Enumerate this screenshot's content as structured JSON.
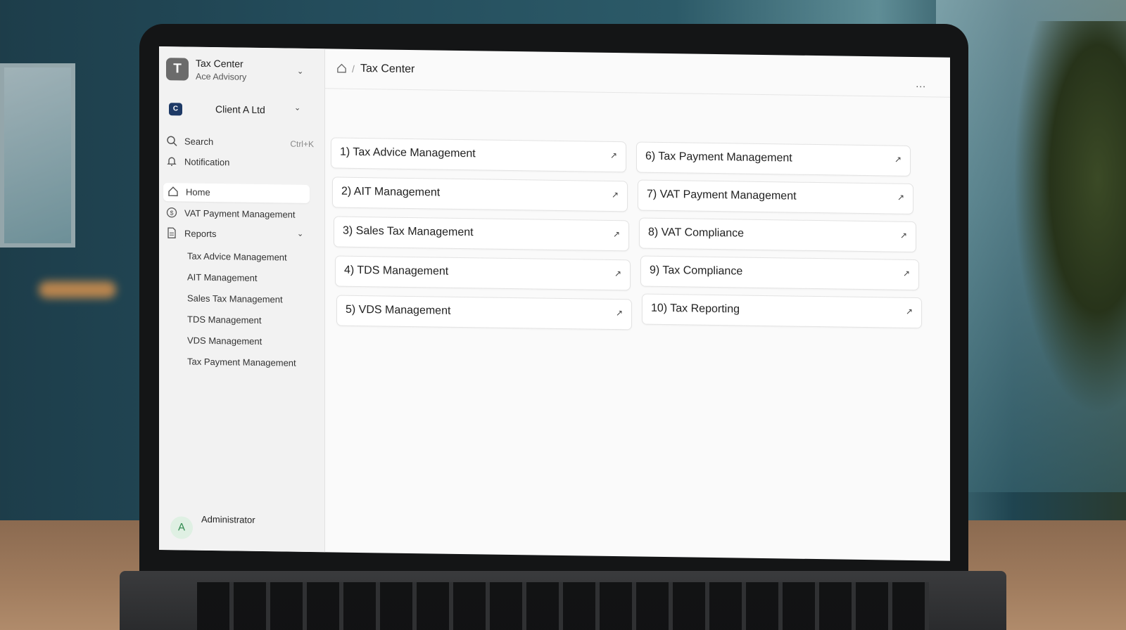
{
  "sidebar": {
    "org": {
      "avatar": "T",
      "name": "Tax Center",
      "sub": "Ace Advisory"
    },
    "client": {
      "badge": "C",
      "name": "Client A Ltd"
    },
    "search": {
      "label": "Search",
      "shortcut": "Ctrl+K"
    },
    "notification": {
      "label": "Notification"
    },
    "nav": [
      {
        "label": "Home",
        "icon": "home-icon"
      },
      {
        "label": "VAT Payment Management",
        "icon": "dollar-circle-icon"
      },
      {
        "label": "Reports",
        "icon": "document-icon"
      }
    ],
    "reports_items": [
      "Tax Advice Management",
      "AIT Management",
      "Sales Tax Management",
      "TDS Management",
      "VDS Management",
      "Tax Payment Management"
    ],
    "user": {
      "avatar": "A",
      "name": "Administrator"
    }
  },
  "header": {
    "breadcrumb_current": "Tax Center",
    "more_label": "..."
  },
  "cards": [
    "1) Tax Advice Management",
    "2) AIT Management",
    "3) Sales Tax Management",
    "4) TDS Management",
    "5) VDS Management",
    "6) Tax Payment Management",
    "7) VAT Payment Management",
    "8) VAT Compliance",
    "9) Tax Compliance",
    "10) Tax Reporting"
  ],
  "colors": {
    "client_badge": "#1e3a66",
    "user_avatar_bg": "#dff0e3",
    "accent_text": "#222222"
  }
}
